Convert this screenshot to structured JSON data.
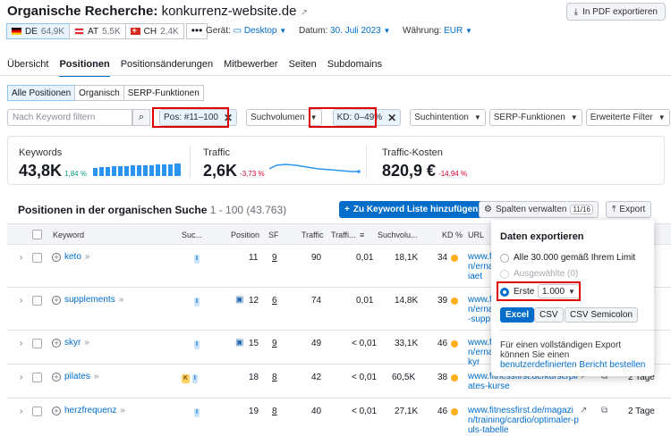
{
  "header": {
    "title_prefix": "Organische Recherche:",
    "domain": "konkurrenz-website.de",
    "pdf_label": "In PDF exportieren",
    "databases": [
      {
        "code": "DE",
        "count": "64,9K",
        "flag": "flag-de"
      },
      {
        "code": "AT",
        "count": "5,5K",
        "flag": "flag-at"
      },
      {
        "code": "CH",
        "count": "2,4K",
        "flag": "flag-ch"
      }
    ],
    "more": "•••",
    "device_label": "Gerät:",
    "device_value": "Desktop",
    "date_label": "Datum:",
    "date_value": "30. Juli 2023",
    "currency_label": "Währung:",
    "currency_value": "EUR"
  },
  "tabs": [
    "Übersicht",
    "Positionen",
    "Positionsänderungen",
    "Mitbewerber",
    "Seiten",
    "Subdomains"
  ],
  "segments": [
    "Alle Positionen",
    "Organisch",
    "SERP-Funktionen"
  ],
  "filters": {
    "search_placeholder": "Nach Keyword filtern",
    "pos": "Pos: #11–100",
    "volume": "Suchvolumen",
    "kd": "KD: 0–49%",
    "intent": "Suchintention",
    "serp": "SERP-Funktionen",
    "advanced": "Erweiterte Filter"
  },
  "kpis": {
    "keywords": {
      "label": "Keywords",
      "value": "43,8K",
      "delta": "1,84 %"
    },
    "traffic": {
      "label": "Traffic",
      "value": "2,6K",
      "delta": "-3,73 %"
    },
    "cost": {
      "label": "Traffic-Kosten",
      "value": "820,9 €",
      "delta": "-14,94 %"
    }
  },
  "section": {
    "title": "Positionen in der organischen Suche",
    "range": "1 - 100 (43.763)",
    "add_label": "Zu Keyword Liste hinzufügen",
    "columns_label": "Spalten verwalten",
    "columns_badge": "11/16",
    "export_label": "Export"
  },
  "columns": {
    "keyword": "Keyword",
    "intent": "Suc...",
    "position": "Position",
    "sf": "SF",
    "traffic": "Traffic",
    "traffic_pct": "Traffi...",
    "volume": "Suchvolu...",
    "kd": "KD %",
    "url": "URL"
  },
  "rows": [
    {
      "keyword": "keto",
      "intent": [
        "I"
      ],
      "position": "11",
      "sf": "9",
      "traffic": "90",
      "pct": "0,01",
      "volume": "18,1K",
      "kd": "34",
      "url": [
        "www.f",
        "n/erna",
        "iaet"
      ],
      "extra": ""
    },
    {
      "keyword": "supplements",
      "intent": [
        "I"
      ],
      "position": "12",
      "sf": "6",
      "traffic": "74",
      "pct": "0,01",
      "volume": "14,8K",
      "kd": "39",
      "url": [
        "www.f",
        "n/erna",
        "-supp"
      ],
      "extra": ""
    },
    {
      "keyword": "skyr",
      "intent": [
        "I"
      ],
      "position": "15",
      "sf": "9",
      "traffic": "49",
      "pct": "< 0,01",
      "volume": "33,1K",
      "kd": "46",
      "url": [
        "www.f",
        "n/erna",
        "kyr"
      ],
      "extra": ""
    },
    {
      "keyword": "pilates",
      "intent": [
        "K",
        "I"
      ],
      "position": "18",
      "sf": "8",
      "traffic": "42",
      "pct": "< 0,01",
      "volume": "60,5K",
      "kd": "38",
      "url": [
        "www.fitnessfirst.de/kurse/pil",
        "ates-kurse"
      ],
      "extra": "2 Tage"
    },
    {
      "keyword": "herzfrequenz",
      "intent": [
        "I"
      ],
      "position": "19",
      "sf": "8",
      "traffic": "40",
      "pct": "< 0,01",
      "volume": "27,1K",
      "kd": "46",
      "url": [
        "www.fitnessfirst.de/magazi",
        "n/training/cardio/optimaler-p",
        "uls-tabelle"
      ],
      "extra": "2 Tage"
    }
  ],
  "export_popup": {
    "title": "Daten exportieren",
    "opt_all": "Alle 30.000 gemäß Ihrem Limit",
    "opt_selected": "Ausgewählte (0)",
    "opt_first": "Erste",
    "first_value": "1.000",
    "formats": [
      "Excel",
      "CSV",
      "CSV Semicolon"
    ],
    "note": "Für einen vollständigen Export können Sie einen",
    "note_link": "benutzerdefinierten Bericht bestellen"
  }
}
